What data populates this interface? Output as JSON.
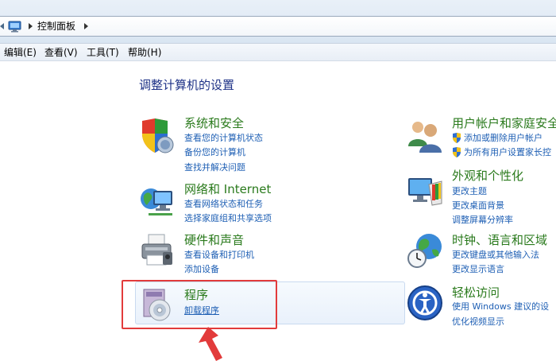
{
  "address": {
    "path": "控制面板"
  },
  "menu": [
    "编辑(E)",
    "查看(V)",
    "工具(T)",
    "帮助(H)"
  ],
  "page_title": "调整计算机的设置",
  "left_categories": [
    {
      "title": "系统和安全",
      "links": [
        "查看您的计算机状态",
        "备份您的计算机",
        "查找并解决问题"
      ],
      "icon": "shield-monitor-icon"
    },
    {
      "title": "网络和 Internet",
      "links": [
        "查看网络状态和任务",
        "选择家庭组和共享选项"
      ],
      "icon": "network-globe-icon"
    },
    {
      "title": "硬件和声音",
      "links": [
        "查看设备和打印机",
        "添加设备"
      ],
      "icon": "printer-icon"
    },
    {
      "title": "程序",
      "links": [
        "卸载程序"
      ],
      "icon": "programs-disc-icon"
    }
  ],
  "right_categories": [
    {
      "title": "用户帐户和家庭安全",
      "links": [
        "添加或删除用户帐户",
        "为所有用户设置家长控"
      ],
      "icon": "users-icon"
    },
    {
      "title": "外观和个性化",
      "links": [
        "更改主题",
        "更改桌面背景",
        "调整屏幕分辨率"
      ],
      "icon": "appearance-monitor-icon"
    },
    {
      "title": "时钟、语言和区域",
      "links": [
        "更改键盘或其他输入法",
        "更改显示语言"
      ],
      "icon": "globe-clock-icon"
    },
    {
      "title": "轻松访问",
      "links": [
        "使用 Windows 建议的设",
        "优化视频显示"
      ],
      "icon": "ease-of-access-icon"
    }
  ],
  "colors": {
    "category_title": "#2a7a1c",
    "link": "#1e5fb4",
    "page_title": "#1e3287",
    "annotation": "#e23b3b"
  }
}
